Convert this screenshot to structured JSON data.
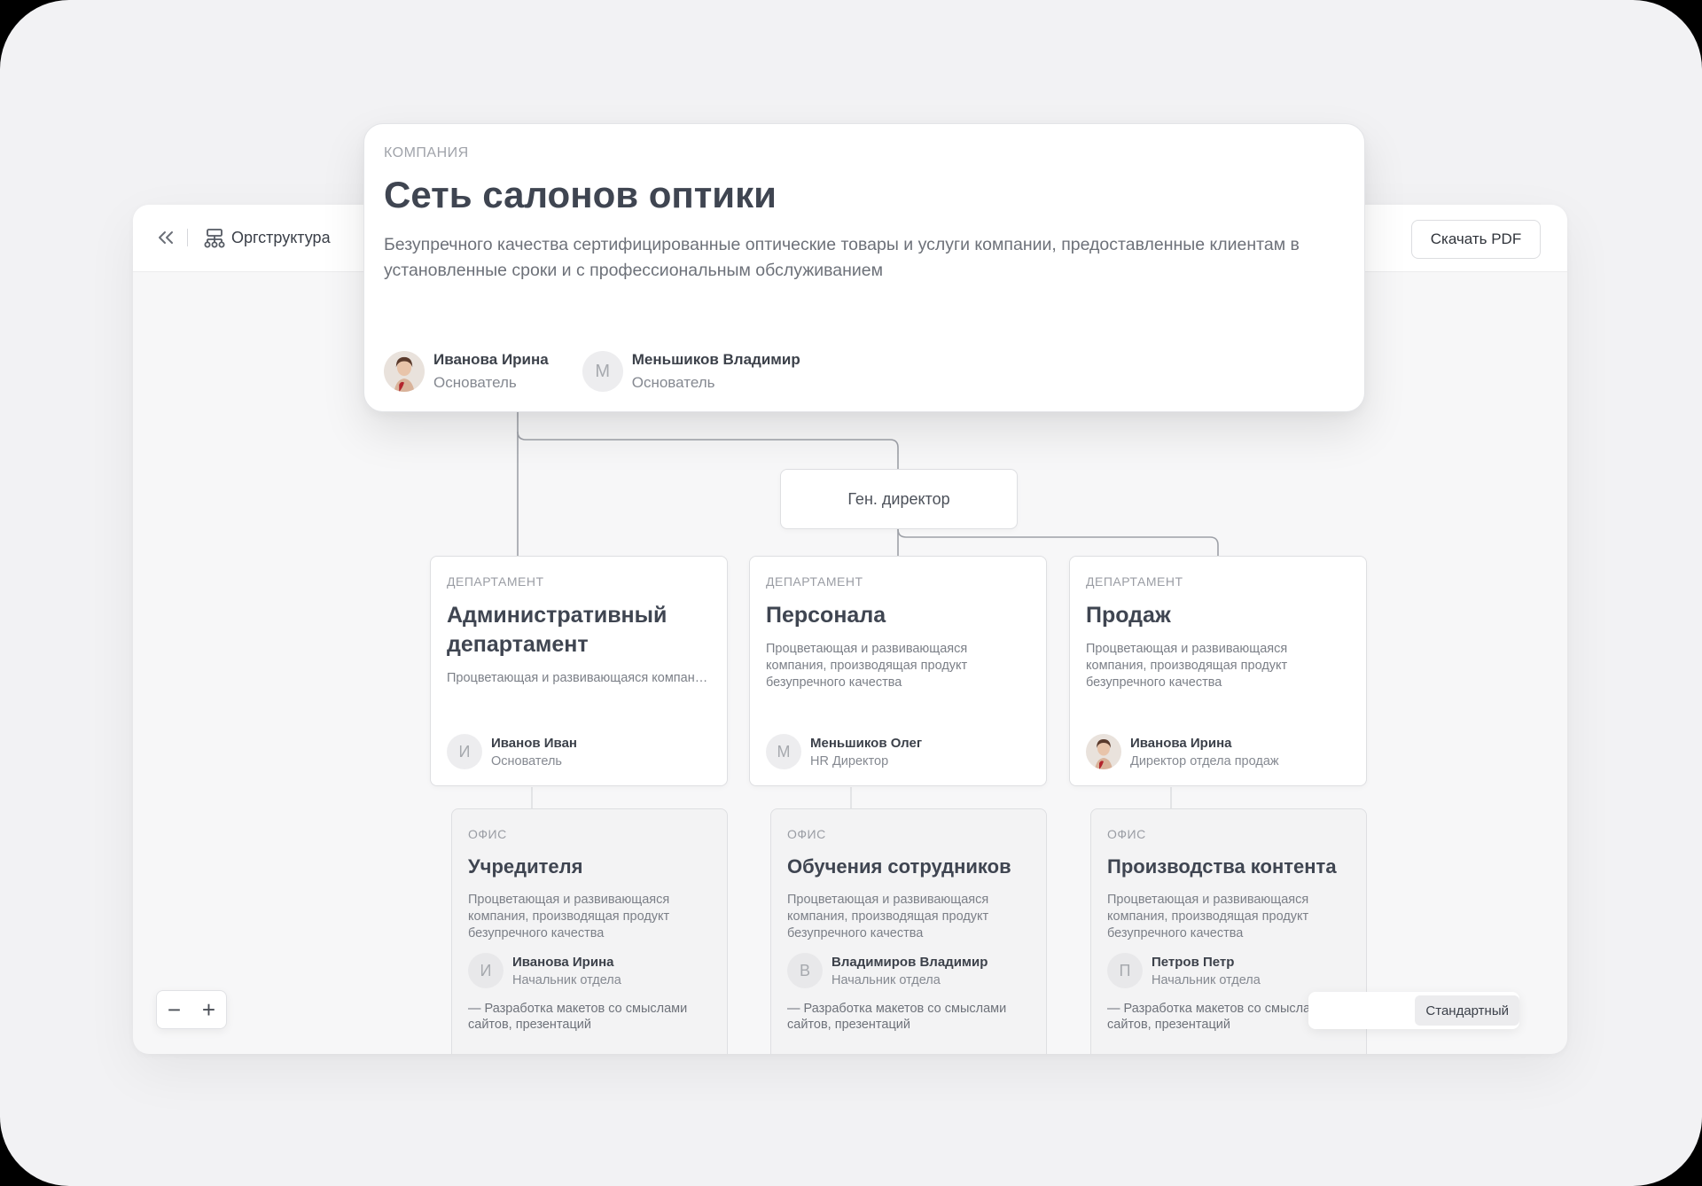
{
  "topbar": {
    "section_label": "Оргструктура",
    "download_label": "Скачать PDF"
  },
  "company": {
    "kicker": "КОМПАНИЯ",
    "title": "Сеть салонов оптики",
    "description": "Безупречного качества сертифицированные оптические товары и услуги компании, предоставленные клиентам в установленные сроки и с профессиональным обслуживанием",
    "founders": [
      {
        "name": "Иванова Ирина",
        "role": "Основатель",
        "avatar": "photo"
      },
      {
        "name": "Меньшиков Владимир",
        "role": "Основатель",
        "initial": "М"
      }
    ]
  },
  "ceo": {
    "label": "Ген. директор"
  },
  "departments": [
    {
      "kicker": "ДЕПАРТАМЕНТ",
      "title": "Административный департамент",
      "description": "Процветающая и развивающаяся компания, производящая продукт безу...",
      "person": {
        "name": "Иванов Иван",
        "role": "Основатель",
        "initial": "И"
      }
    },
    {
      "kicker": "ДЕПАРТАМЕНТ",
      "title": "Персонала",
      "description": "Процветающая и развивающаяся компания, производящая продукт безупречного качества",
      "person": {
        "name": "Меньшиков Олег",
        "role": "HR Директор",
        "initial": "М"
      }
    },
    {
      "kicker": "ДЕПАРТАМЕНТ",
      "title": "Продаж",
      "description": "Процветающая и развивающаяся компания, производящая продукт безупречного качества",
      "person": {
        "name": "Иванова Ирина",
        "role": "Директор отдела продаж",
        "avatar": "photo"
      }
    }
  ],
  "offices": [
    {
      "kicker": "ОФИС",
      "title": "Учредителя",
      "description": "Процветающая и развивающаяся компания, производящая продукт безупречного качества",
      "person": {
        "name": "Иванова Ирина",
        "role": "Начальник отдела",
        "initial": "И"
      },
      "task": "— Разработка макетов со смыслами сайтов, презентаций"
    },
    {
      "kicker": "ОФИС",
      "title": "Обучения сотрудников",
      "description": "Процветающая и развивающаяся компания, производящая продукт безупречного качества",
      "person": {
        "name": "Владимиров Владимир",
        "role": "Начальник отдела",
        "initial": "В"
      },
      "task": "— Разработка макетов со смыслами сайтов, презентаций"
    },
    {
      "kicker": "ОФИС",
      "title": "Производства контента",
      "description": "Процветающая и развивающаяся компания, производящая продукт безупречного качества",
      "person": {
        "name": "Петров Петр",
        "role": "Начальник отдела",
        "initial": "П"
      },
      "task": "— Разработка макетов со смыслами сайтов, презентаций"
    }
  ],
  "zoom": {
    "minus": "−",
    "plus": "+"
  },
  "view": {
    "selected": "Стандартный"
  },
  "icons": {
    "back": "double-chevron-left-icon",
    "org": "org-chart-icon"
  }
}
